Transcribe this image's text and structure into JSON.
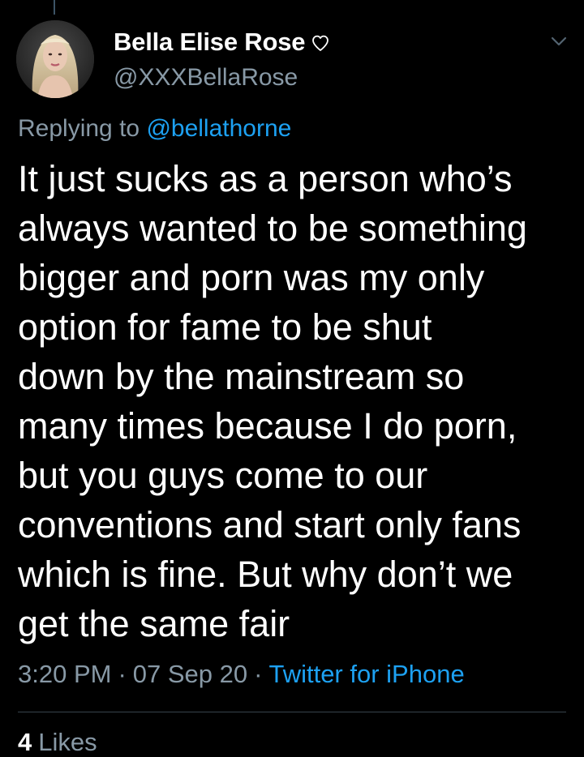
{
  "tweet": {
    "author": {
      "display_name": "Bella Elise Rose",
      "handle": "@XXXBellaRose"
    },
    "reply": {
      "prefix": "Replying to",
      "mention": "@bellathorne"
    },
    "text_lines": [
      "It just sucks as a person who’s",
      "always wanted to be something",
      "bigger and porn was my only",
      "option for fame to be shut",
      "down by the mainstream so",
      "many times because I do porn,",
      "but you guys come to our",
      "conventions and start only fans",
      "which is fine. But why don’t we",
      "get the same fair"
    ],
    "time": "3:20 PM",
    "date": "07 Sep 20",
    "separator": "·",
    "source": "Twitter for iPhone",
    "likes": {
      "count": "4",
      "label": "Likes"
    }
  },
  "icons": {
    "name_badge": "heart-outline-icon",
    "menu": "chevron-down-icon"
  },
  "colors": {
    "background": "#000000",
    "text": "#ffffff",
    "secondary": "#8899a6",
    "accent": "#1da1f2",
    "divider": "#38444d"
  }
}
